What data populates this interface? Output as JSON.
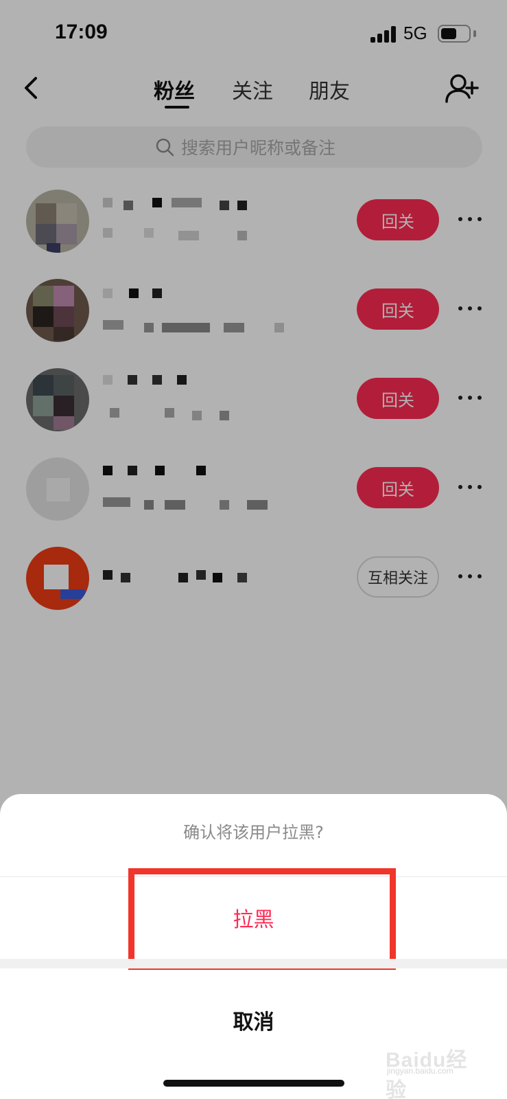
{
  "status_bar": {
    "time": "17:09",
    "network": "5G"
  },
  "header": {
    "tabs": [
      {
        "label": "粉丝",
        "active": true
      },
      {
        "label": "关注",
        "active": false
      },
      {
        "label": "朋友",
        "active": false
      }
    ],
    "icons": {
      "back": "chevron-left-icon",
      "add_friend": "person-add-icon"
    }
  },
  "search": {
    "placeholder": "搜索用户昵称或备注"
  },
  "list": {
    "rows": [
      {
        "action_label": "回关",
        "action_type": "follow-back"
      },
      {
        "action_label": "回关",
        "action_type": "follow-back"
      },
      {
        "action_label": "回关",
        "action_type": "follow-back"
      },
      {
        "action_label": "回关",
        "action_type": "follow-back"
      },
      {
        "action_label": "互相关注",
        "action_type": "mutual"
      }
    ]
  },
  "sheet": {
    "title": "确认将该用户拉黑?",
    "confirm_label": "拉黑",
    "cancel_label": "取消"
  },
  "watermark": {
    "logo": "Baidu经验",
    "sub": "jingyan.baidu.com"
  },
  "colors": {
    "accent": "#ff2b54",
    "highlight": "#f2352a",
    "overlay": "rgba(0,0,0,0.30)"
  }
}
